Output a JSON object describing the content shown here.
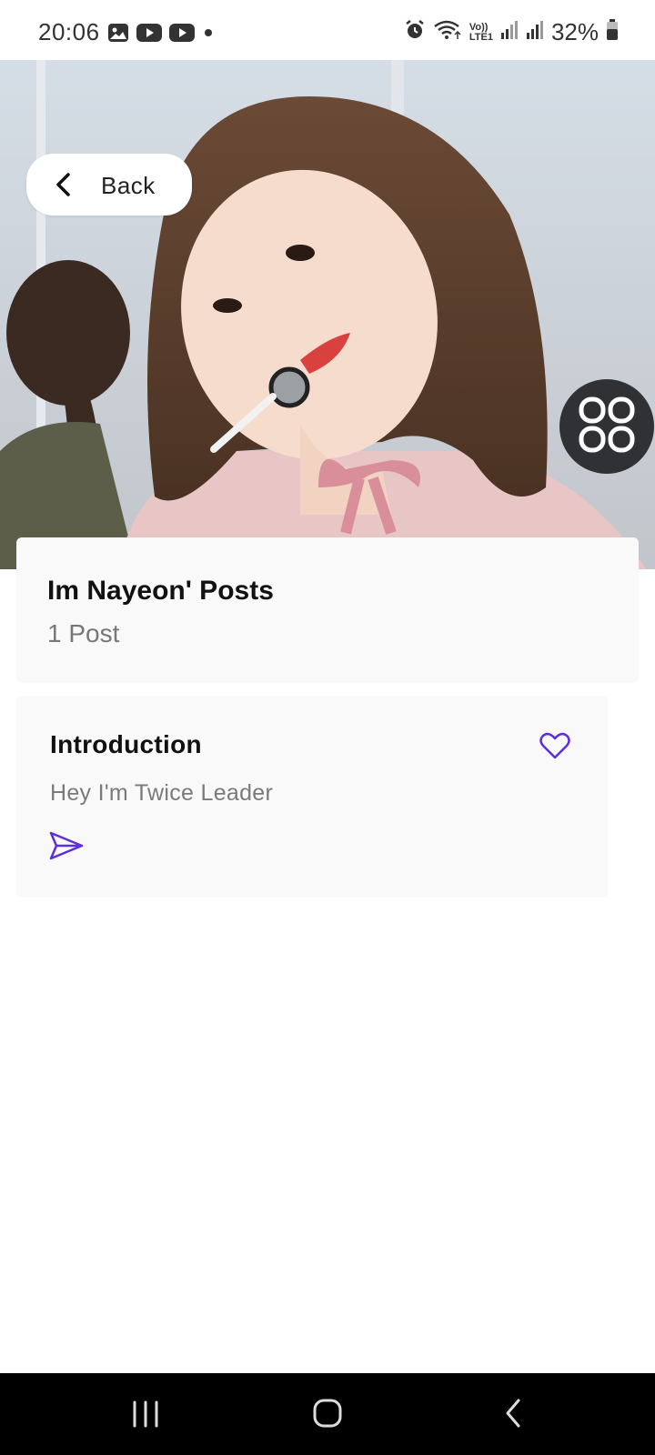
{
  "status_bar": {
    "time": "20:06",
    "battery": "32%",
    "notification_icons": [
      "gallery-icon",
      "youtube-icon",
      "youtube-icon",
      "dot-icon"
    ],
    "system_icons": [
      "alarm-icon",
      "wifi-icon",
      "volte-icon",
      "signal-icon",
      "signal-icon",
      "battery-icon"
    ],
    "volte_label": "Vo))",
    "lte_label": "LTE1"
  },
  "header": {
    "back_label": "Back"
  },
  "profile": {
    "posts_title": "Im Nayeon' Posts",
    "posts_count": "1 Post"
  },
  "post": {
    "title": "Introduction",
    "body": "Hey I'm Twice Leader"
  },
  "colors": {
    "accent": "#5b2ee0",
    "card_bg": "#f9f9f9",
    "grid_button_bg": "#2f3134"
  }
}
